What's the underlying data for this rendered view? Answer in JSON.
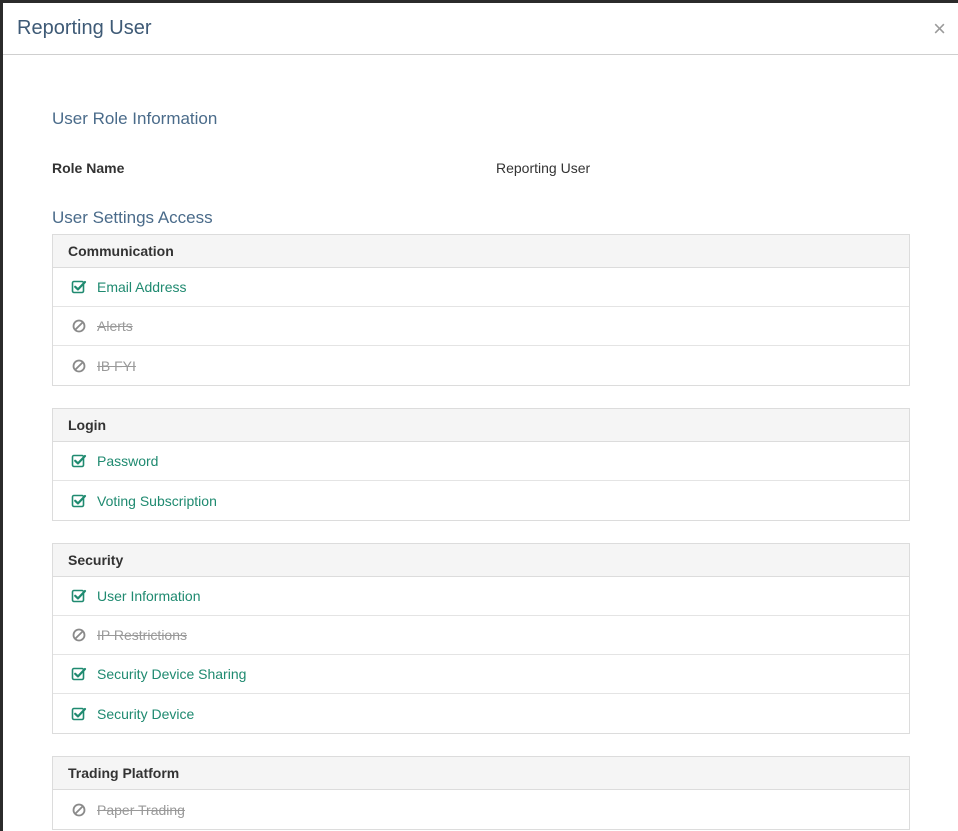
{
  "modal": {
    "title": "Reporting User",
    "close": "×"
  },
  "role_info": {
    "heading": "User Role Information",
    "role_name_label": "Role Name",
    "role_name_value": "Reporting User"
  },
  "settings": {
    "heading": "User Settings Access",
    "groups": [
      {
        "name": "Communication",
        "items": [
          {
            "label": "Email Address",
            "enabled": true,
            "icon": "checked-box-icon"
          },
          {
            "label": "Alerts",
            "enabled": false,
            "icon": "ban-icon"
          },
          {
            "label": "IB FYI",
            "enabled": false,
            "icon": "ban-icon"
          }
        ]
      },
      {
        "name": "Login",
        "items": [
          {
            "label": "Password",
            "enabled": true,
            "icon": "checked-box-icon"
          },
          {
            "label": "Voting Subscription",
            "enabled": true,
            "icon": "checked-box-icon"
          }
        ]
      },
      {
        "name": "Security",
        "items": [
          {
            "label": "User Information",
            "enabled": true,
            "icon": "checked-box-icon"
          },
          {
            "label": "IP Restrictions",
            "enabled": false,
            "icon": "ban-icon"
          },
          {
            "label": "Security Device Sharing",
            "enabled": true,
            "icon": "checked-box-icon"
          },
          {
            "label": "Security Device",
            "enabled": true,
            "icon": "checked-box-icon"
          }
        ]
      },
      {
        "name": "Trading Platform",
        "items": [
          {
            "label": "Paper Trading",
            "enabled": false,
            "icon": "ban-icon"
          }
        ]
      }
    ]
  },
  "colors": {
    "enabled": "#1f8a70",
    "disabled": "#999999",
    "title": "#3e5a76"
  }
}
